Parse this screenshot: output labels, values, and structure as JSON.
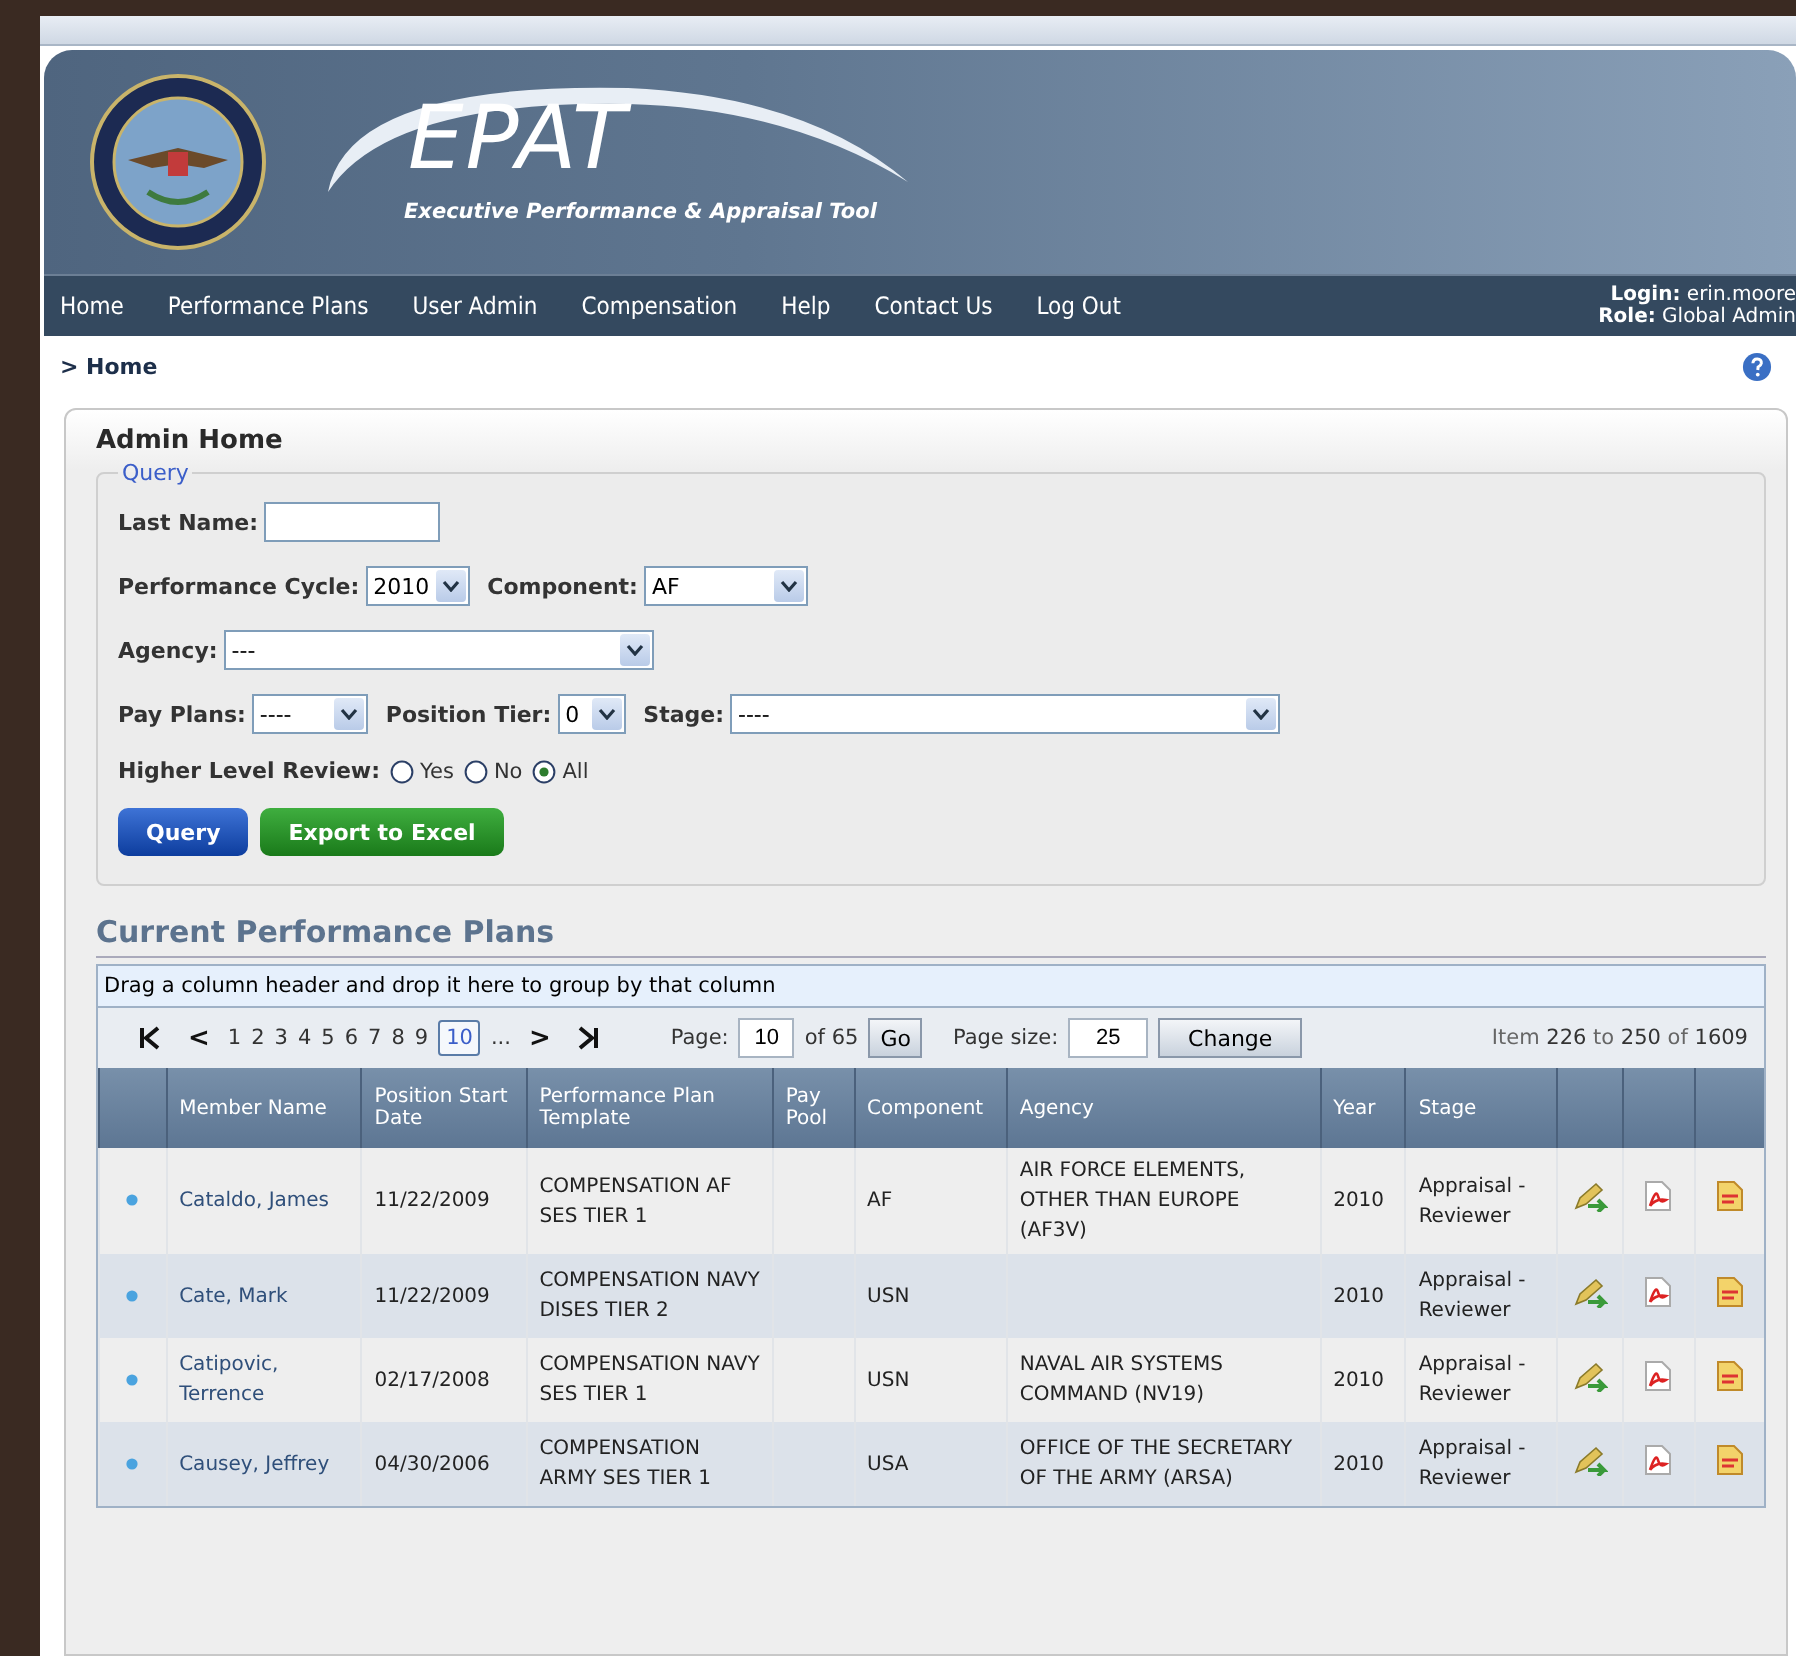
{
  "app": {
    "title": "EPAT",
    "subtitle": "Executive Performance & Appraisal Tool"
  },
  "nav": [
    "Home",
    "Performance Plans",
    "User Admin",
    "Compensation",
    "Help",
    "Contact Us",
    "Log Out"
  ],
  "user": {
    "login_label": "Login:",
    "login": "erin.moore",
    "role_label": "Role:",
    "role": "Global Admin"
  },
  "breadcrumb": "> Home",
  "panel_title": "Admin Home",
  "query": {
    "legend": "Query",
    "last_name": {
      "label": "Last Name:"
    },
    "performance_cycle": {
      "label": "Performance Cycle:",
      "value": "2010"
    },
    "component": {
      "label": "Component:",
      "value": "AF"
    },
    "agency": {
      "label": "Agency:",
      "value": "---"
    },
    "pay_plans": {
      "label": "Pay Plans:",
      "value": "----"
    },
    "position_tier": {
      "label": "Position Tier:",
      "value": "0"
    },
    "stage": {
      "label": "Stage:",
      "value": "----"
    },
    "review": {
      "label": "Higher Level Review:",
      "options": [
        {
          "label": "Yes",
          "selected": false
        },
        {
          "label": "No",
          "selected": false
        },
        {
          "label": "All",
          "selected": true
        }
      ]
    },
    "buttons": [
      {
        "label": "Query",
        "kind": "primary"
      },
      {
        "label": "Export to Excel",
        "kind": "export"
      }
    ]
  },
  "section_title": "Current Performance Plans",
  "group_hint": "Drag a column header and drop it here to group by that column",
  "pager": {
    "prev": "<",
    "pages": [
      {
        "label": "1",
        "selected": false
      },
      {
        "label": "2",
        "selected": false
      },
      {
        "label": "3",
        "selected": false
      },
      {
        "label": "4",
        "selected": false
      },
      {
        "label": "5",
        "selected": false
      },
      {
        "label": "6",
        "selected": false
      },
      {
        "label": "7",
        "selected": false
      },
      {
        "label": "8",
        "selected": false
      },
      {
        "label": "9",
        "selected": false
      },
      {
        "label": "10",
        "selected": true
      }
    ],
    "more": "...",
    "next": ">",
    "page_label": "Page:",
    "page": "10",
    "of": "of 65",
    "go": "Go",
    "size_label": "Page size:",
    "size": "25",
    "change": "Change",
    "summary": "Item **226** to **250** of **1609**"
  },
  "table": {
    "columns": [
      null,
      "Member Name",
      "Position Start Date",
      "Performance Plan Template",
      "Pay Pool",
      "Component",
      "Agency",
      "Year",
      "Stage",
      null,
      null,
      null
    ],
    "rows": [
      {
        "name": "Cataldo, James",
        "start": "11/22/2009",
        "template": "COMPENSATION AF SES TIER 1",
        "component": "AF",
        "agency": "AIR FORCE ELEMENTS, OTHER THAN EUROPE (AF3V)",
        "year": "2010",
        "stage": "Appraisal - Reviewer"
      },
      {
        "name": "Cate, Mark",
        "start": "11/22/2009",
        "template": "COMPENSATION NAVY DISES TIER 2",
        "component": "USN",
        "year": "2010",
        "stage": "Appraisal - Reviewer"
      },
      {
        "name": "Catipovic, Terrence",
        "start": "02/17/2008",
        "template": "COMPENSATION NAVY SES TIER 1",
        "component": "USN",
        "agency": "NAVAL AIR SYSTEMS COMMAND (NV19)",
        "year": "2010",
        "stage": "Appraisal - Reviewer"
      },
      {
        "name": "Causey, Jeffrey",
        "start": "04/30/2006",
        "template": "COMPENSATION ARMY SES TIER 1",
        "component": "USA",
        "agency": "OFFICE OF THE SECRETARY OF THE ARMY (ARSA)",
        "year": "2010",
        "stage": "Appraisal - Reviewer"
      }
    ]
  }
}
